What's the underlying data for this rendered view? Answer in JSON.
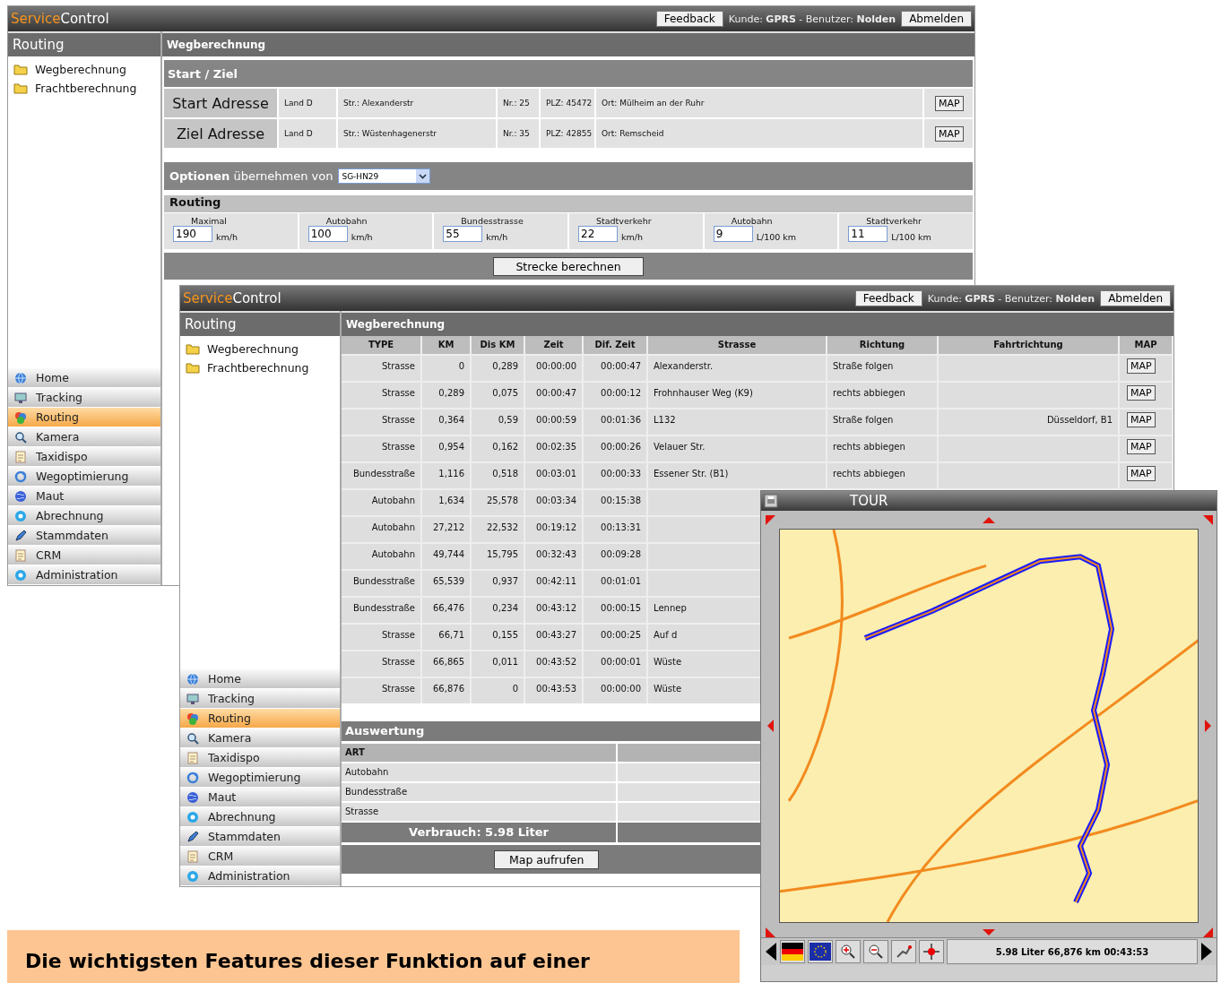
{
  "windows": [
    {
      "kind": "form",
      "brand_accent": "Service",
      "brand": "Control",
      "feedback": "Feedback",
      "user_info": "Kunde: **GPRS** -  Benutzer: **Nolden**",
      "logout": "Abmelden",
      "sidebar": {
        "title": "Routing",
        "tree": [
          "Wegberechnung",
          "Frachtberechnung"
        ],
        "nav": [
          {
            "label": "Home",
            "selected": false
          },
          {
            "label": "Tracking",
            "selected": false
          },
          {
            "label": "Routing",
            "selected": true
          },
          {
            "label": "Kamera",
            "selected": false
          },
          {
            "label": "Taxidispo",
            "selected": false
          },
          {
            "label": "Wegoptimierung",
            "selected": false
          },
          {
            "label": "Maut",
            "selected": false
          },
          {
            "label": "Abrechnung",
            "selected": false
          },
          {
            "label": "Stammdaten",
            "selected": false
          },
          {
            "label": "CRM",
            "selected": false
          },
          {
            "label": "Administration",
            "selected": false
          }
        ]
      },
      "content_title": "Wegberechnung",
      "form": {
        "section_title": "Start / Ziel",
        "addresses": [
          {
            "label": "Start Adresse",
            "land": "Land D",
            "street": "Str.: Alexanderstr",
            "nr": "Nr.: 25",
            "plz": "PLZ: 45472",
            "ort": "Ort: Mülheim an der Ruhr",
            "map": "MAP"
          },
          {
            "label": "Ziel Adresse",
            "land": "Land D",
            "street": "Str.: Wüstenhagenerstr",
            "nr": "Nr.: 35",
            "plz": "PLZ: 42855",
            "ort": "Ort: Remscheid",
            "map": "MAP"
          }
        ],
        "options": {
          "label": "**Optionen** übernehmen von",
          "select": "SG-HN29"
        },
        "routing": {
          "title": "Routing",
          "fields": [
            {
              "label": "Maximal",
              "value": "190",
              "unit": "km/h"
            },
            {
              "label": "Autobahn",
              "value": "100",
              "unit": "km/h"
            },
            {
              "label": "Bundesstrasse",
              "value": "55",
              "unit": "km/h"
            },
            {
              "label": "Stadtverkehr",
              "value": "22",
              "unit": "km/h"
            },
            {
              "label": "Autobahn",
              "value": "9",
              "unit": "L/100 km"
            },
            {
              "label": "Stadtverkehr",
              "value": "11",
              "unit": "L/100 km"
            }
          ]
        },
        "calc_button": "Strecke berechnen"
      }
    },
    {
      "kind": "table",
      "brand_accent": "Service",
      "brand": "Control",
      "feedback": "Feedback",
      "user_info": "Kunde: **GPRS** -  Benutzer: **Nolden**",
      "logout": "Abmelden",
      "sidebar": {
        "title": "Routing",
        "tree": [
          "Wegberechnung",
          "Frachtberechnung"
        ],
        "nav": [
          {
            "label": "Home",
            "selected": false
          },
          {
            "label": "Tracking",
            "selected": false
          },
          {
            "label": "Routing",
            "selected": true
          },
          {
            "label": "Kamera",
            "selected": false
          },
          {
            "label": "Taxidispo",
            "selected": false
          },
          {
            "label": "Wegoptimierung",
            "selected": false
          },
          {
            "label": "Maut",
            "selected": false
          },
          {
            "label": "Abrechnung",
            "selected": false
          },
          {
            "label": "Stammdaten",
            "selected": false
          },
          {
            "label": "CRM",
            "selected": false
          },
          {
            "label": "Administration",
            "selected": false
          }
        ]
      },
      "content_title": "Wegberechnung",
      "table": {
        "columns": [
          "TYPE",
          "KM",
          "Dis KM",
          "Zeit",
          "Dif. Zeit",
          "Strasse",
          "Richtung",
          "Fahrtrichtung",
          "MAP"
        ],
        "rows": [
          {
            "type": "Strasse",
            "km": "0",
            "dis_km": "0,289",
            "zeit": "00:00:00",
            "dif_zeit": "00:00:47",
            "strasse": "Alexanderstr.",
            "richtung": "Straße folgen",
            "map": "MAP"
          },
          {
            "type": "Strasse",
            "km": "0,289",
            "dis_km": "0,075",
            "zeit": "00:00:47",
            "dif_zeit": "00:00:12",
            "strasse": "Frohnhauser Weg (K9)",
            "richtung": "rechts abbiegen",
            "map": "MAP"
          },
          {
            "type": "Strasse",
            "km": "0,364",
            "dis_km": "0,59",
            "zeit": "00:00:59",
            "dif_zeit": "00:01:36",
            "strasse": "L132",
            "richtung": "Straße folgen",
            "fahrtrichtung": "Düsseldorf, B1",
            "map": "MAP"
          },
          {
            "type": "Strasse",
            "km": "0,954",
            "dis_km": "0,162",
            "zeit": "00:02:35",
            "dif_zeit": "00:00:26",
            "strasse": "Velauer Str.",
            "richtung": "rechts abbiegen",
            "map": "MAP"
          },
          {
            "type": "Bundesstraße",
            "km": "1,116",
            "dis_km": "0,518",
            "zeit": "00:03:01",
            "dif_zeit": "00:00:33",
            "strasse": "Essener Str. (B1)",
            "richtung": "rechts abbiegen",
            "map": "MAP"
          },
          {
            "type": "Autobahn",
            "km": "1,634",
            "dis_km": "25,578",
            "zeit": "00:03:34",
            "dif_zeit": "00:15:38"
          },
          {
            "type": "Autobahn",
            "km": "27,212",
            "dis_km": "22,532",
            "zeit": "00:19:12",
            "dif_zeit": "00:13:31"
          },
          {
            "type": "Autobahn",
            "km": "49,744",
            "dis_km": "15,795",
            "zeit": "00:32:43",
            "dif_zeit": "00:09:28"
          },
          {
            "type": "Bundesstraße",
            "km": "65,539",
            "dis_km": "0,937",
            "zeit": "00:42:11",
            "dif_zeit": "00:01:01"
          },
          {
            "type": "Bundesstraße",
            "km": "66,476",
            "dis_km": "0,234",
            "zeit": "00:43:12",
            "dif_zeit": "00:00:15",
            "strasse": "Lennep"
          },
          {
            "type": "Strasse",
            "km": "66,71",
            "dis_km": "0,155",
            "zeit": "00:43:27",
            "dif_zeit": "00:00:25",
            "strasse": "Auf d"
          },
          {
            "type": "Strasse",
            "km": "66,865",
            "dis_km": "0,011",
            "zeit": "00:43:52",
            "dif_zeit": "00:00:01",
            "strasse": "Wüste"
          },
          {
            "type": "Strasse",
            "km": "66,876",
            "dis_km": "0",
            "zeit": "00:43:53",
            "dif_zeit": "00:00:00",
            "strasse": "Wüste"
          }
        ]
      },
      "summary": {
        "title": "Auswertung",
        "header": "ART",
        "rows": [
          "Autobahn",
          "Bundesstraße",
          "Strasse"
        ],
        "total": "Verbrauch: 5.98 Liter"
      },
      "map_button": "Map aufrufen"
    }
  ],
  "tour": {
    "title": "TOUR",
    "status": "5.98 Liter 66,876 km 00:43:53"
  },
  "banner": {
    "text": "Die wichtigsten Features dieser Funktion auf einer"
  }
}
